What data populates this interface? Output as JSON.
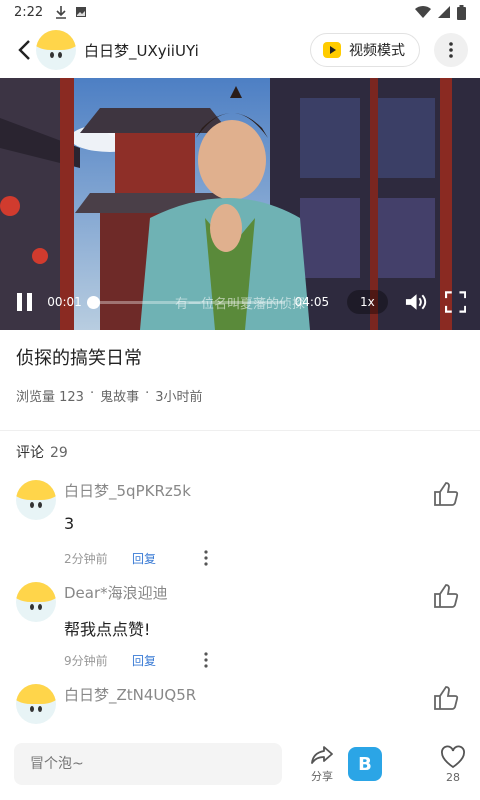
{
  "status_bar": {
    "time": "2:22"
  },
  "header": {
    "username": "白日梦_UXyiiUYi",
    "video_mode_label": "视频模式"
  },
  "video": {
    "current_time": "00:01",
    "duration": "04:05",
    "progress": 0.004,
    "speed_label": "1x",
    "subtitle": "有一位名叫夏藩的侦探"
  },
  "info": {
    "title": "侦探的搞笑日常",
    "views": "浏览量 123",
    "category": "鬼故事",
    "time_ago": "3小时前",
    "separator": "·"
  },
  "comments_section": {
    "label": "评论",
    "count": "29",
    "items": [
      {
        "name": "白日梦_5qPKRz5k",
        "text": "3",
        "time": "2分钟前",
        "reply": "回复"
      },
      {
        "name": "Dear*海浪迎迪",
        "text": "帮我点点赞!",
        "time": "9分钟前",
        "reply": "回复"
      },
      {
        "name": "白日梦_ZtN4UQ5R",
        "text": "",
        "time": "",
        "reply": ""
      }
    ]
  },
  "bottom_bar": {
    "input_placeholder": "冒个泡~",
    "share_label": "分享",
    "like_count": "28"
  },
  "colors": {
    "accent_yellow": "#ffcc00",
    "reply_blue": "#3a7bd5",
    "app_badge": "#2ba5e6"
  }
}
